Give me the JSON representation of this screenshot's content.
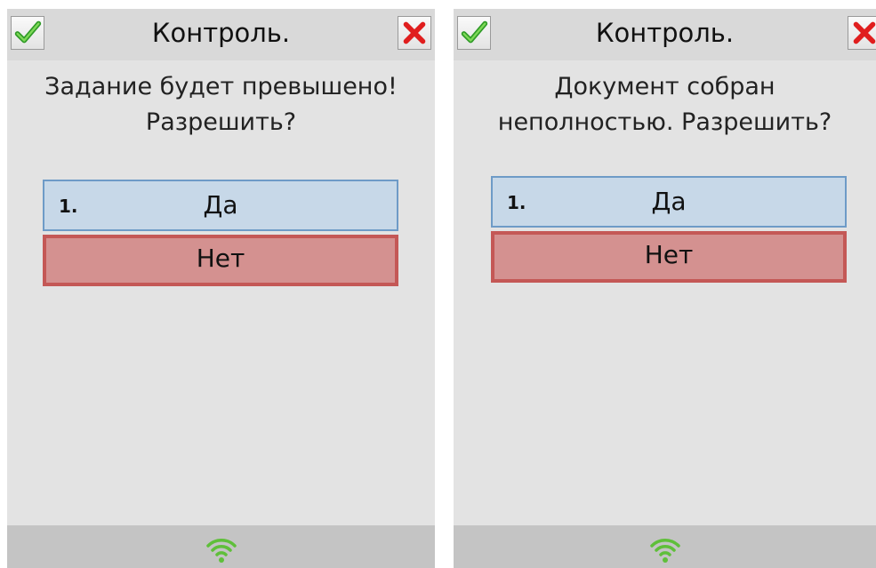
{
  "colors": {
    "panel_bg": "#e3e3e3",
    "header_bg": "#d9d9d9",
    "footer_bg": "#c4c4c4",
    "yes_bg": "#c7d8e8",
    "yes_border": "#6e9bc7",
    "no_bg": "#d49190",
    "no_border": "#c45856",
    "wifi": "#5fbf3a"
  },
  "dialogs": [
    {
      "title": "Контроль.",
      "ok_icon": "check-icon",
      "cancel_icon": "close-icon",
      "message_line1": "Задание будет превышено!",
      "message_line2": "Разрешить?",
      "yes_number": "1.",
      "yes_label": "Да",
      "no_label": "Нет",
      "status_icon": "wifi-icon"
    },
    {
      "title": "Контроль.",
      "ok_icon": "check-icon",
      "cancel_icon": "close-icon",
      "message_line1": "Документ собран",
      "message_line2": "неполностью. Разрешить?",
      "yes_number": "1.",
      "yes_label": "Да",
      "no_label": "Нет",
      "status_icon": "wifi-icon"
    }
  ]
}
